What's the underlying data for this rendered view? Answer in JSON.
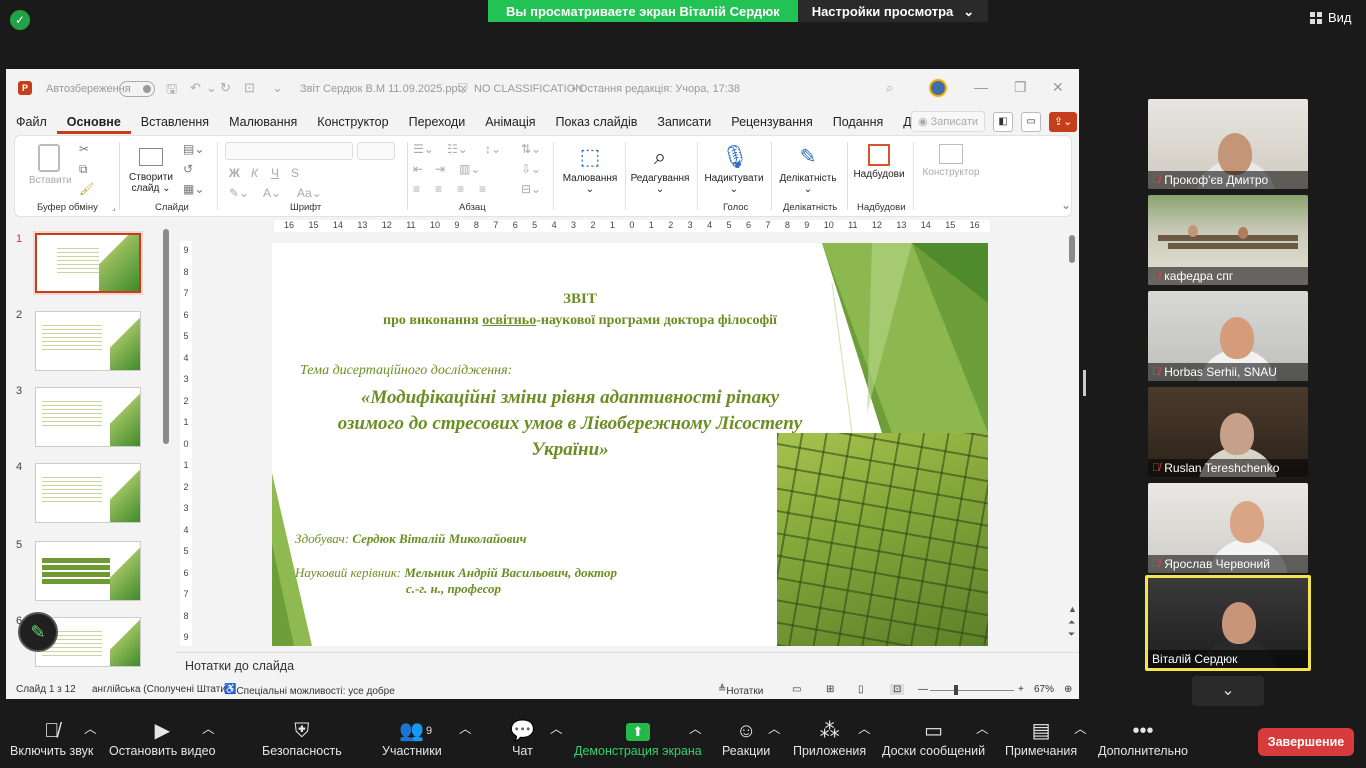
{
  "banner": {
    "viewing_text": "Вы просматриваете экран Віталій Сердюк",
    "view_settings": "Настройки просмотра",
    "view_button": "Вид"
  },
  "ppt": {
    "autosave": "Автозбереження",
    "filename": "Звіт Сердюк В.М 11.09.2025.pptx",
    "classification": "NO CLASSIFICATION",
    "last_edit": "• Остання редакція: Учора, 17:38",
    "menu": [
      "Файл",
      "Основне",
      "Вставлення",
      "Малювання",
      "Конструктор",
      "Переходи",
      "Анімація",
      "Показ слайдів",
      "Записати",
      "Рецензування",
      "Подання",
      "Довідка"
    ],
    "record_label": "Записати",
    "ribbon": {
      "paste": "Вставити",
      "clipboard": "Буфер обміну",
      "new_slide_1": "Створити",
      "new_slide_2": "слайд",
      "slides": "Слайди",
      "font": "Шрифт",
      "paragraph": "Абзац",
      "drawing": "Малювання",
      "editing": "Редагування",
      "dictate": "Надиктувати",
      "voice": "Голос",
      "sensitivity": "Делікатність",
      "sensitivity_grp": "Делікатність",
      "addins": "Надбудови",
      "addins_grp": "Надбудови",
      "designer": "Конструктор"
    },
    "ruler_h": [
      "16",
      "15",
      "14",
      "13",
      "12",
      "11",
      "10",
      "9",
      "8",
      "7",
      "6",
      "5",
      "4",
      "3",
      "2",
      "1",
      "0",
      "1",
      "2",
      "3",
      "4",
      "5",
      "6",
      "7",
      "8",
      "9",
      "10",
      "11",
      "12",
      "13",
      "14",
      "15",
      "16"
    ],
    "ruler_v": [
      "9",
      "8",
      "7",
      "6",
      "5",
      "4",
      "3",
      "2",
      "1",
      "0",
      "1",
      "2",
      "3",
      "4",
      "5",
      "6",
      "7",
      "8",
      "9"
    ],
    "thumbs": [
      "1",
      "2",
      "3",
      "4",
      "5",
      "6"
    ],
    "slide": {
      "title": "ЗВІТ",
      "subtitle_pre": "про виконання ",
      "subtitle_ul": "освітньо",
      "subtitle_post": "-наукової програми доктора філософії",
      "topic_label": "Тема дисертаційного дослідження:",
      "topic_1": "«Модифікаційні зміни рівня адаптивності ріпаку",
      "topic_2": "озимого до стресових умов в Лівобережному Лісостепу",
      "topic_3": "України»",
      "applicant_label": "Здобувач:",
      "applicant_name": "Сердюк Віталій Миколайович",
      "advisor_label": "Науковий керівник:",
      "advisor_name": "Мельник Андрій Васильович, доктор",
      "advisor_name_2": "с.-г. н., професор"
    },
    "notes": "Нотатки до слайда",
    "status": {
      "slide": "Слайд 1 з 12",
      "lang": "англійська (Сполучені Штати)",
      "accessibility": "Спеціальні можливості: усе добре",
      "notes": "Нотатки",
      "zoom": "67%"
    },
    "colors": {
      "accent": "#c43e1c",
      "slide_green": "#6b8e23"
    }
  },
  "participants": [
    "Прокоф'єв Дмитро",
    "кафедра спг",
    "Horbas Serhii, SNAU",
    "Ruslan Tereshchenko",
    "Ярослав Червоний",
    "Віталій Сердюк"
  ],
  "toolbar": {
    "unmute": "Включить звук",
    "stop_video": "Остановить видео",
    "security": "Безопасность",
    "participants": "Участники",
    "participants_count": "9",
    "chat": "Чат",
    "share": "Демонстрация экрана",
    "reactions": "Реакции",
    "apps": "Приложения",
    "boards": "Доски сообщений",
    "notes": "Примечания",
    "more": "Дополнительно",
    "end": "Завершение"
  }
}
